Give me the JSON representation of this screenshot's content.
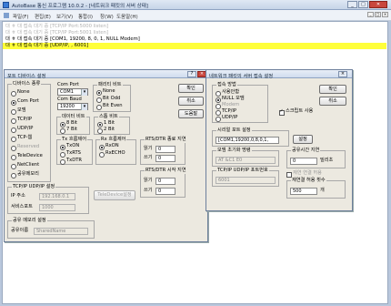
{
  "window": {
    "title": "AutoBase 통신 프로그램 10.0.2 - [네트워크 패킷의 서버 상태]"
  },
  "menu": [
    "파일(F)",
    "편집(E)",
    "보기(V)",
    "통합(I)",
    "창(W)",
    "도움말(H)"
  ],
  "log_lines": [
    {
      "text": "대 ㅎ 대 접속 대기 중 [TCP/IP Port:5000 listen]",
      "style": "dim"
    },
    {
      "text": "대 ㅎ 대 접속 대기 중 [TCP/IP Port:5001 listen]",
      "style": "dim"
    },
    {
      "text": "대 ㅎ 대 접속 대기 중 [COM1, 19200, 8, 0, 1, NULL Modem]",
      "style": "dark"
    },
    {
      "text": "대 ㅎ 대 접속 대기 중 [UDP/IP, , 6001]",
      "style": "hl"
    },
    {
      "text": "",
      "style": "dim"
    },
    {
      "text": "",
      "style": "dim"
    },
    {
      "text": "",
      "style": "dim"
    },
    {
      "text": "",
      "style": "dim"
    },
    {
      "text": "",
      "style": "dim"
    },
    {
      "text": "",
      "style": "dim"
    },
    {
      "text": "",
      "style": "dim"
    },
    {
      "text": "",
      "style": "dim"
    },
    {
      "text": "",
      "style": "dim"
    },
    {
      "text": "",
      "style": "dim"
    },
    {
      "text": "",
      "style": "dim"
    },
    {
      "text": "",
      "style": "dim"
    },
    {
      "text": "",
      "style": "dim"
    },
    {
      "text": "",
      "style": "dim"
    },
    {
      "text": "",
      "style": "dim"
    },
    {
      "text": "",
      "style": "dim"
    },
    {
      "text": "",
      "style": "dim"
    },
    {
      "text": "",
      "style": "dim"
    },
    {
      "text": "",
      "style": "dim"
    },
    {
      "text": "",
      "style": "dim"
    },
    {
      "text": "",
      "style": "dim"
    },
    {
      "text": "",
      "style": "dim"
    },
    {
      "text": "",
      "style": "dim"
    },
    {
      "text": "",
      "style": "dim"
    },
    {
      "text": "",
      "style": "dim"
    },
    {
      "text": "",
      "style": "dim"
    },
    {
      "text": "",
      "style": "dim"
    },
    {
      "text": "",
      "style": "dim"
    },
    {
      "text": "",
      "style": "dim"
    },
    {
      "text": "",
      "style": "dim"
    },
    {
      "text": "",
      "style": "dim"
    },
    {
      "text": "",
      "style": "dim"
    },
    {
      "text": "",
      "style": "dim"
    },
    {
      "text": "",
      "style": "dim"
    },
    {
      "text": "",
      "style": "dim"
    },
    {
      "text": "",
      "style": "dim"
    },
    {
      "text": "",
      "style": "dim"
    },
    {
      "text": "",
      "style": "dim"
    }
  ],
  "dialog1": {
    "title": "포트 디바이스 설정",
    "device_group": "디바이스 종류",
    "device_options": [
      {
        "label": "None",
        "on": false,
        "dis": false
      },
      {
        "label": "Com Port",
        "on": true,
        "dis": false
      },
      {
        "label": "모뎀",
        "on": false,
        "dis": false
      },
      {
        "label": "TCP/IP",
        "on": false,
        "dis": false
      },
      {
        "label": "UDP/IP",
        "on": false,
        "dis": false
      },
      {
        "label": "TCP-웹",
        "on": false,
        "dis": false
      },
      {
        "label": "Reserved",
        "on": false,
        "dis": true
      },
      {
        "label": "TeleDevice",
        "on": false,
        "dis": false
      },
      {
        "label": "NetClient",
        "on": false,
        "dis": false
      },
      {
        "label": "공유메모리",
        "on": false,
        "dis": false
      }
    ],
    "com_port_label": "Com Port",
    "com_port_value": "COM1",
    "com_baud_label": "Com Baud",
    "com_baud_value": "19200",
    "parity_group": "패리티 비트",
    "parity_options": [
      {
        "label": "None",
        "on": true
      },
      {
        "label": "Bit Odd",
        "on": false
      },
      {
        "label": "Bit Even",
        "on": false
      }
    ],
    "data_group": "데이터 비트",
    "data_options": [
      {
        "label": "8 Bit",
        "on": true
      },
      {
        "label": "7 Bit",
        "on": false
      }
    ],
    "stop_group": "스톱 비트",
    "stop_options": [
      {
        "label": "1 Bit",
        "on": true
      },
      {
        "label": "2 Bit",
        "on": false
      }
    ],
    "tx_group": "Tx 흐름제어",
    "tx_options": [
      {
        "label": "TxON",
        "on": true
      },
      {
        "label": "TxRTS",
        "on": false
      },
      {
        "label": "TxDTR",
        "on": false
      }
    ],
    "rx_group": "Rx 흐름제어",
    "rx_options": [
      {
        "label": "RxON",
        "on": true
      },
      {
        "label": "RxECHO",
        "on": false
      }
    ],
    "rts_group": "RTS/DTR 종료 지연",
    "read_label": "읽기",
    "read_value": "0",
    "write_label": "쓰기",
    "write_value": "0",
    "tcp_group": "TCP/IP UDP/IP 설정",
    "ip_label": "IP 주소",
    "ip_value": "192.168.0.1",
    "service_label": "서비스포트",
    "service_value": "1000",
    "teledevice_btn": "TeleDevice설정",
    "rts_group2": "RTS/DTR 시작 지연",
    "read2_value": "0",
    "write2_value": "0",
    "shared_group": "공유 메모리 설정",
    "shared_label": "공유이름",
    "shared_value": "SharedName",
    "ok": "확인",
    "cancel": "취소",
    "help": "도움말"
  },
  "dialog2": {
    "title": "네트워크 패킷의 서버 접속 설정",
    "conn_group": "접속 방법",
    "conn_options": [
      {
        "label": "사용안함",
        "on": false,
        "dis": false
      },
      {
        "label": "NULL 모뎀",
        "on": true,
        "dis": false
      },
      {
        "label": "Modem",
        "on": false,
        "dis": true
      },
      {
        "label": "TCP/IP",
        "on": false,
        "dis": false
      },
      {
        "label": "UDP/IP",
        "on": false,
        "dis": false
      }
    ],
    "ok": "확인",
    "cancel": "취소",
    "script_cb": "스크립트 사용",
    "script_group": "시리얼 포트 설정",
    "script_value": "[COM1,19200,0,8,0,1,",
    "script_btn": "설정",
    "modem_group": "모뎀 초기화 명령",
    "modem_value": "AT &C1 E0",
    "idle_group": "공유시간 지연",
    "idle_value": "0",
    "idle_unit": "밀리초",
    "tcp_group": "TCP/IP UDP/IP 포트번호",
    "tcp_value": "6001",
    "retry_cb": "재연 연결 허용",
    "retry_label": "재연결 허용 횟수",
    "retry_value": "500",
    "retry_unit": "개"
  }
}
